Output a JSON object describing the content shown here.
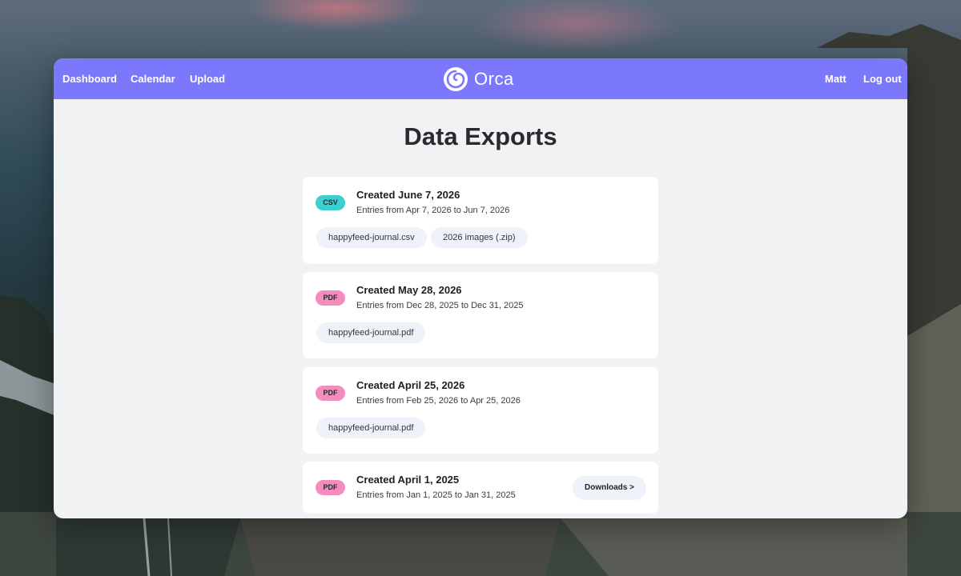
{
  "nav": {
    "links": [
      "Dashboard",
      "Calendar",
      "Upload"
    ],
    "brand": "Orca",
    "user": "Matt",
    "logout": "Log out"
  },
  "page": {
    "title": "Data Exports"
  },
  "exports": [
    {
      "format": "CSV",
      "title": "Created June 7, 2026",
      "range": "Entries from Apr 7, 2026 to Jun 7, 2026",
      "files": [
        "happyfeed-journal.csv",
        "2026 images (.zip)"
      ]
    },
    {
      "format": "PDF",
      "title": "Created May 28, 2026",
      "range": "Entries from Dec 28, 2025 to Dec 31, 2025",
      "files": [
        "happyfeed-journal.pdf"
      ]
    },
    {
      "format": "PDF",
      "title": "Created April 25, 2026",
      "range": "Entries from Feb 25, 2026 to Apr 25, 2026",
      "files": [
        "happyfeed-journal.pdf"
      ]
    },
    {
      "format": "PDF",
      "title": "Created April 1, 2025",
      "range": "Entries from Jan 1, 2025 to Jan 31, 2025",
      "action": "Downloads >"
    }
  ],
  "colors": {
    "navbar": "#7c78fb",
    "csv_badge": "#3ccfcf",
    "pdf_badge": "#f48cc0",
    "background": "#f1f2f4"
  },
  "icons": {
    "brand": "orca-spiral-logo-icon"
  }
}
